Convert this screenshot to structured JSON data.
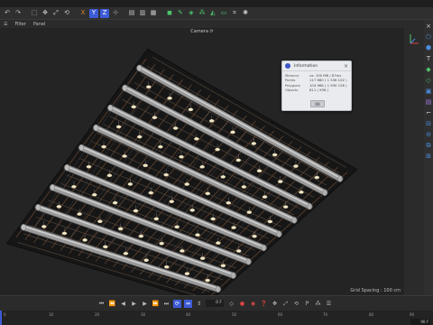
{
  "menu": {
    "items": [
      "Filter",
      "Panel"
    ]
  },
  "viewport": {
    "camera_label": "Camera ⟳",
    "grid_spacing": "Grid Spacing : 100 cm"
  },
  "info_dialog": {
    "title": "Information",
    "rows": [
      {
        "key": "Memory",
        "value": "ca. 100 MB / 87ms"
      },
      {
        "key": "Points",
        "value": "117 680 ( 1 536 102 )"
      },
      {
        "key": "Polygons",
        "value": "104 968 ( 1 930 126 )"
      },
      {
        "key": "Objects",
        "value": "811 ( 936 )"
      }
    ],
    "ok_label": "OK"
  },
  "timeline": {
    "current_frame": "0 F",
    "end_frame": "90 F",
    "ruler_ticks": [
      "0",
      "10",
      "20",
      "30",
      "40",
      "50",
      "60",
      "70",
      "80",
      "90"
    ]
  },
  "colors": {
    "accent": "#3d5bd6",
    "viewport_bg": "#242424",
    "dialog_bg": "#e9ebee",
    "record": "#e04545"
  }
}
